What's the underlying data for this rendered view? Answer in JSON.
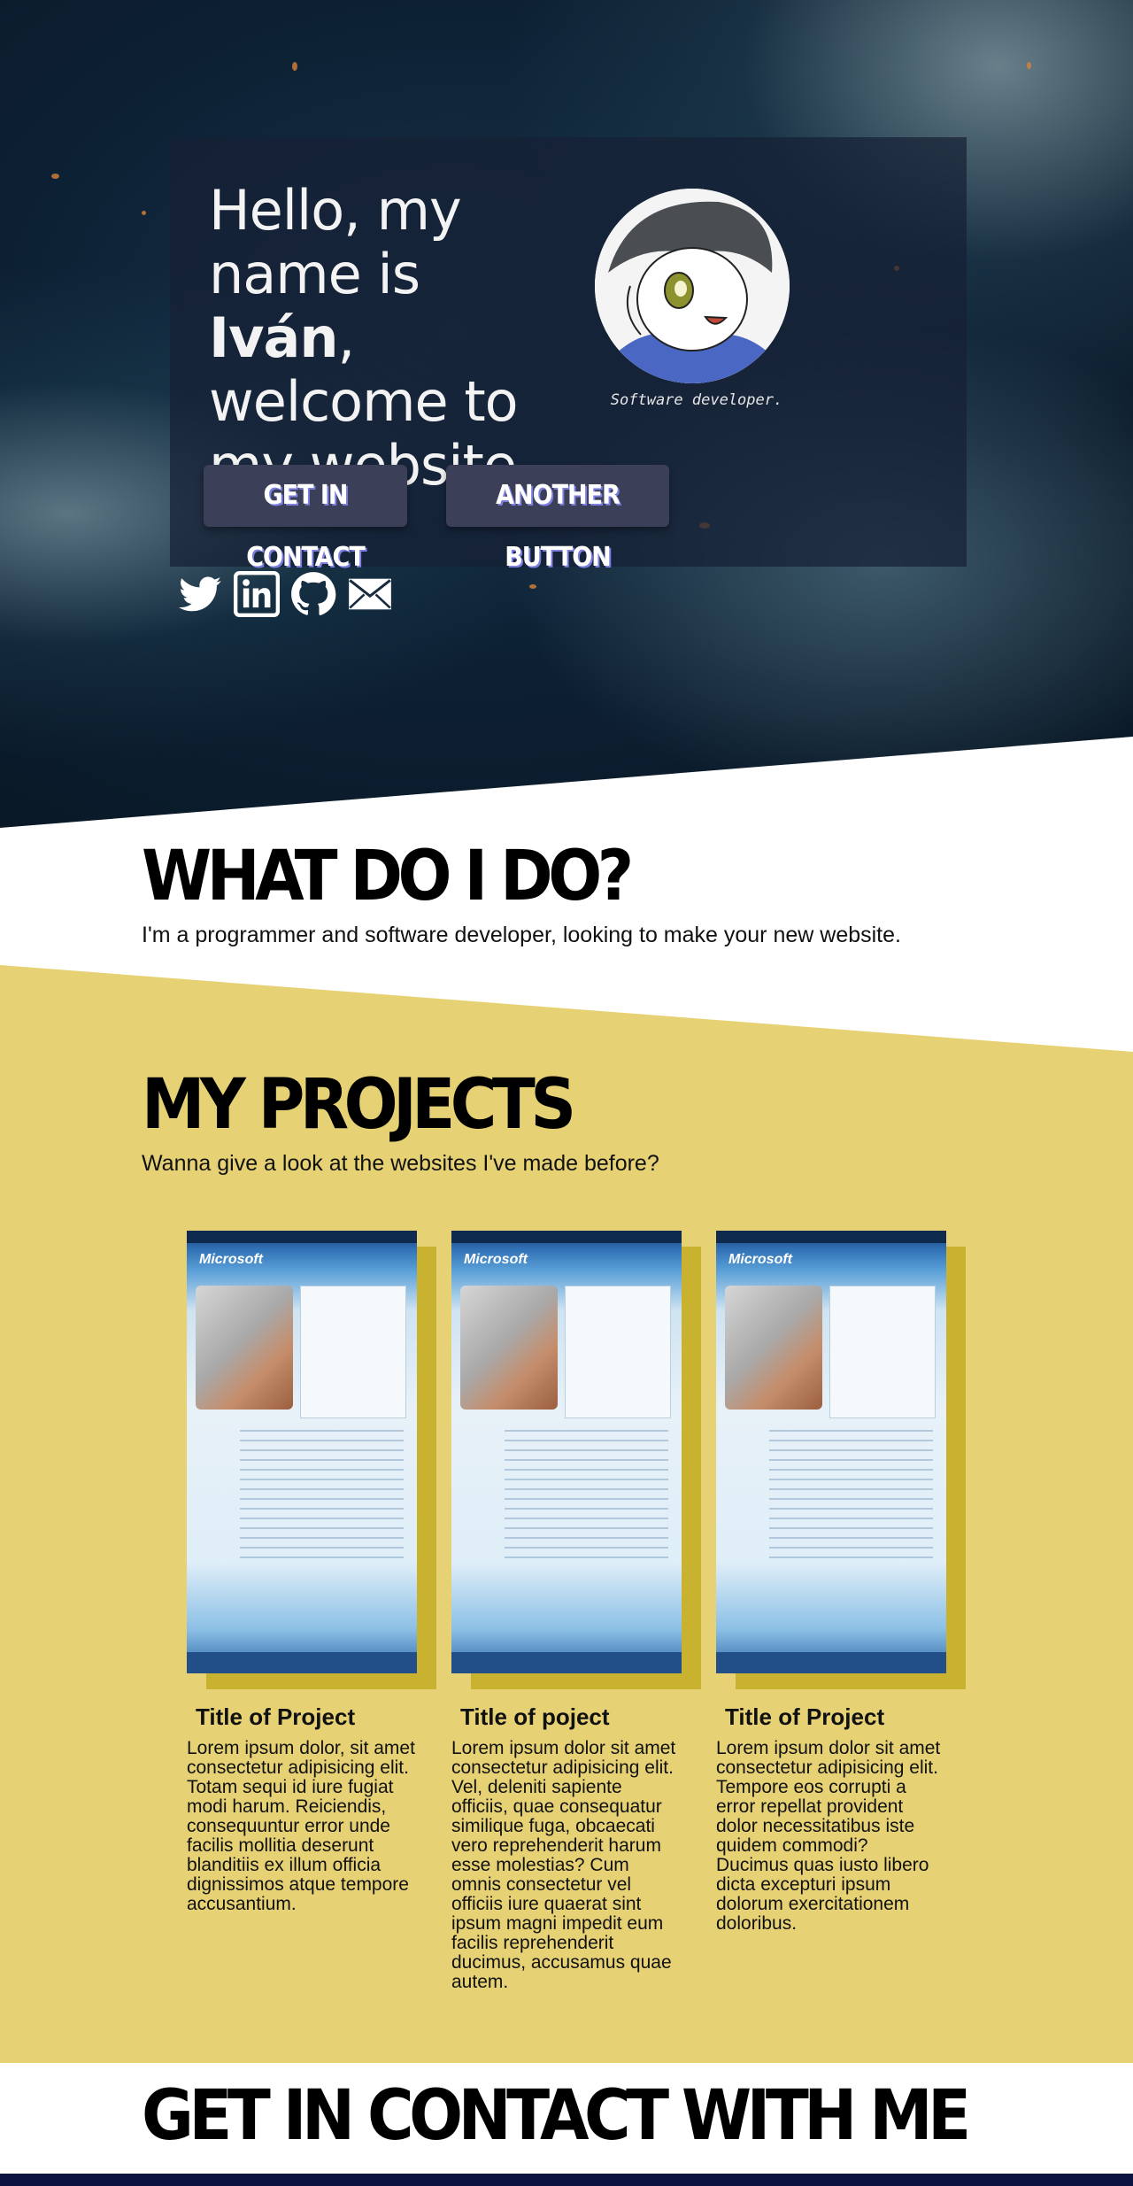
{
  "hero": {
    "headline_part1": "Hello, my name is ",
    "headline_name": "Iván",
    "headline_part2": ", welcome to my website",
    "tagline": "Software developer.",
    "buttons": {
      "contact": "GET IN CONTACT",
      "another": "ANOTHER BUTTON"
    },
    "social_icons": [
      "twitter-icon",
      "linkedin-icon",
      "github-icon",
      "mail-icon"
    ]
  },
  "what": {
    "title": "WHAT DO I DO?",
    "text": "I'm a programmer and software developer, looking to make your new website."
  },
  "projects": {
    "title": "MY PROJECTS",
    "text": "Wanna give a look at the websites I've made before?",
    "items": [
      {
        "title": "Title of Project",
        "image_logo": "Microsoft",
        "description": "Lorem ipsum dolor, sit amet consectetur adipisicing elit. Totam sequi id iure fugiat modi harum. Reiciendis, consequuntur error unde facilis mollitia deserunt blanditiis ex illum officia dignissimos atque tempore accusantium."
      },
      {
        "title": "Title of poject",
        "image_logo": "Microsoft",
        "description": "Lorem ipsum dolor sit amet consectetur adipisicing elit. Vel, deleniti sapiente officiis, quae consequatur similique fuga, obcaecati vero reprehenderit harum esse molestias? Cum omnis consectetur vel officiis iure quaerat sint ipsum magni impedit eum facilis reprehenderit ducimus, accusamus quae autem."
      },
      {
        "title": "Title of Project",
        "image_logo": "Microsoft",
        "description": "Lorem ipsum dolor sit amet consectetur adipisicing elit. Tempore eos corrupti a error repellat provident dolor necessitatibus iste quidem commodi? Ducimus quas iusto libero dicta excepturi ipsum dolorum exercitationem doloribus."
      }
    ]
  },
  "contact": {
    "title": "GET IN CONTACT WITH ME"
  },
  "colors": {
    "projects_bg": "#e6d274",
    "project_shadow": "#c9b22f",
    "hero_card": "#16203a",
    "button_bg": "#3b3f57",
    "button_text_shadow": "#7c7fe0"
  }
}
